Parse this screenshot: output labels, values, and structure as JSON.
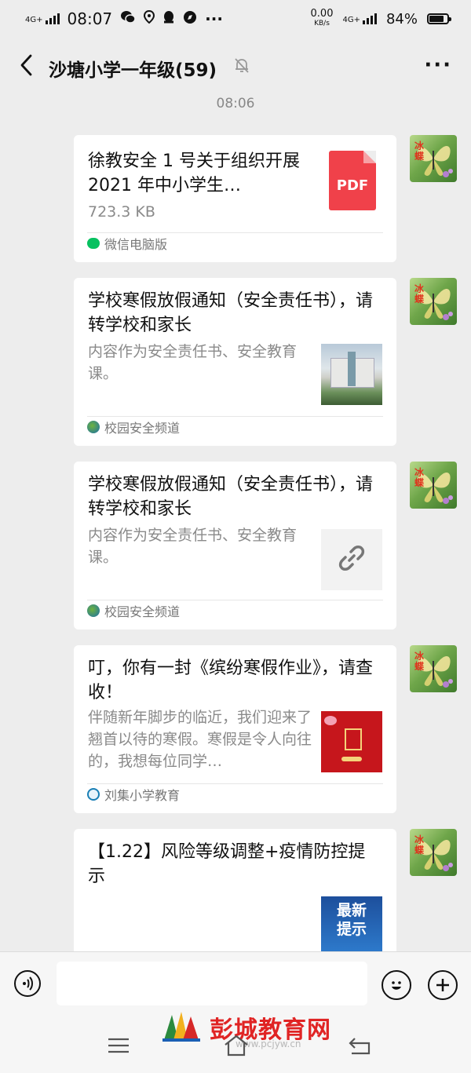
{
  "status_bar": {
    "network_label": "4G+",
    "time": "08:07",
    "speed_value": "0.00",
    "speed_unit": "KB/s",
    "network_label_right": "4G+",
    "battery": "84%",
    "battery_level": 0.84,
    "icons": [
      "wechat-icon",
      "location-icon",
      "qq-icon",
      "compass-icon",
      "more-dots-icon"
    ]
  },
  "header": {
    "title": "沙塘小学一年级(59)",
    "back_icon": "chevron-left-icon",
    "mute_icon": "bell-off-icon",
    "more_icon": "more-icon"
  },
  "timestamp": "08:06",
  "messages": [
    {
      "type": "file",
      "title": "徐教安全 1 号关于组织开展 2021 年中小学生…",
      "size": "723.3 KB",
      "file_type_label": "PDF",
      "source": "微信电脑版"
    },
    {
      "type": "article",
      "title": "学校寒假放假通知（安全责任书），请转学校和家长",
      "desc": "内容作为安全责任书、安全教育课。",
      "source": "校园安全频道"
    },
    {
      "type": "article",
      "title": "学校寒假放假通知（安全责任书），请转学校和家长",
      "desc": "内容作为安全责任书、安全教育课。",
      "source": "校园安全频道"
    },
    {
      "type": "article",
      "title": "叮，你有一封《缤纷寒假作业》，请查收！",
      "desc": "伴随新年脚步的临近，我们迎来了翘首以待的寒假。寒假是令人向往的，我想每位同学…",
      "source": "刘集小学教育"
    },
    {
      "type": "article",
      "title": "【1.22】风险等级调整+疫情防控提示",
      "thumb_text": "最新提示"
    }
  ],
  "avatar": {
    "text": "冰蝶"
  },
  "bottom": {
    "voice_icon": "voice-icon",
    "emoji_icon": "emoji-icon",
    "plus_icon": "plus-icon",
    "watermark": "彭城教育网",
    "watermark_sub": "www.pcjyw.cn"
  },
  "colors": {
    "pdf_red": "#f0414a",
    "wechat_green": "#07c160"
  }
}
